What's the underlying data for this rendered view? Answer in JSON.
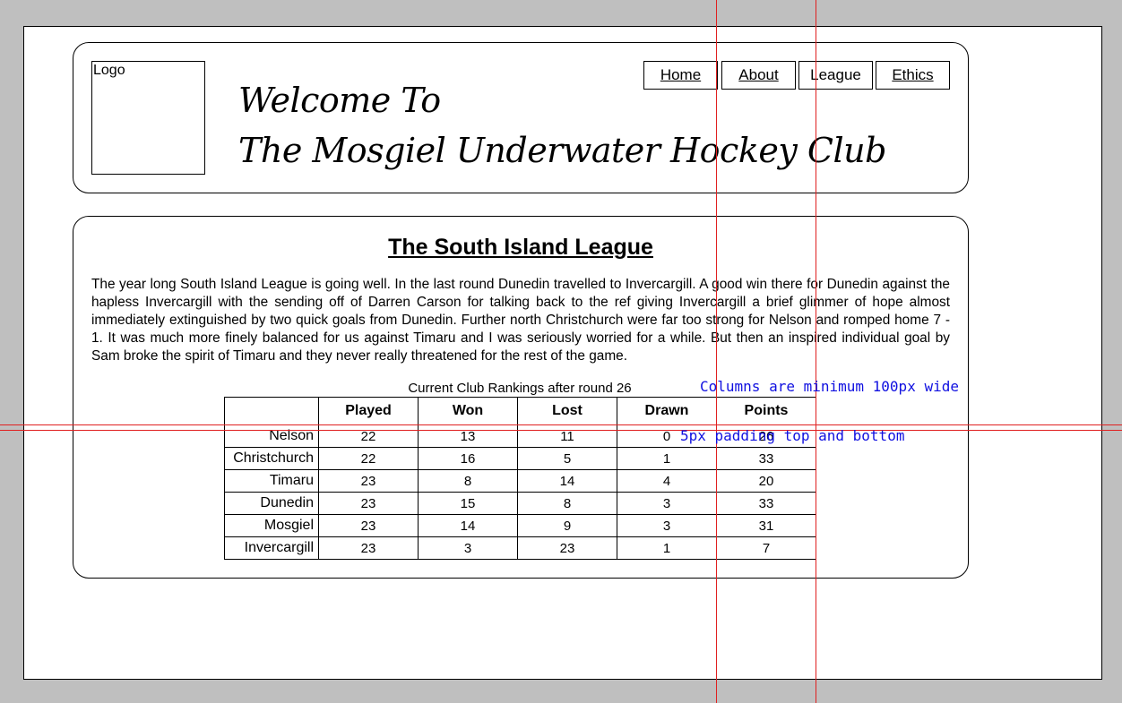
{
  "header": {
    "logo_label": "Logo",
    "welcome_line1": "Welcome To",
    "welcome_line2": "The Mosgiel Underwater Hockey Club"
  },
  "nav": {
    "items": [
      {
        "label": "Home",
        "underlined": true
      },
      {
        "label": "About",
        "underlined": true
      },
      {
        "label": "League",
        "underlined": false
      },
      {
        "label": "Ethics",
        "underlined": true
      }
    ]
  },
  "main": {
    "title": "The South Island League",
    "paragraph": "The year long South Island League is going well. In the last round Dunedin travelled to Invercargill. A good win there for Dunedin against the hapless Invercargill with the sending off of Darren Carson for talking back to the ref giving Invercargill a brief glimmer of hope almost immediately extinguished by two quick goals from Dunedin. Further north Christchurch were far too strong for Nelson and romped home 7 - 1. It was much more finely balanced for us against Timaru and I was seriously worried for a while. But then an inspired individual goal by Sam broke the spirit of Timaru and they never really threatened for the rest of the game."
  },
  "table": {
    "caption": "Current Club Rankings after round 26",
    "columns": [
      "",
      "Played",
      "Won",
      "Lost",
      "Drawn",
      "Points"
    ],
    "rows": [
      [
        "Nelson",
        "22",
        "13",
        "11",
        "0",
        "26"
      ],
      [
        "Christchurch",
        "22",
        "16",
        "5",
        "1",
        "33"
      ],
      [
        "Timaru",
        "23",
        "8",
        "14",
        "4",
        "20"
      ],
      [
        "Dunedin",
        "23",
        "15",
        "8",
        "3",
        "33"
      ],
      [
        "Mosgiel",
        "23",
        "14",
        "9",
        "3",
        "31"
      ],
      [
        "Invercargill",
        "23",
        "3",
        "23",
        "1",
        "7"
      ]
    ]
  },
  "annotations": {
    "columns_note": "Columns are minimum 100px wide",
    "padding_note": "5px padding top and bottom"
  },
  "colors": {
    "guide_lines": "#e02020",
    "annotation_text": "#1010e0",
    "page_background": "#ffffff",
    "canvas_background": "#bfbfbf"
  }
}
